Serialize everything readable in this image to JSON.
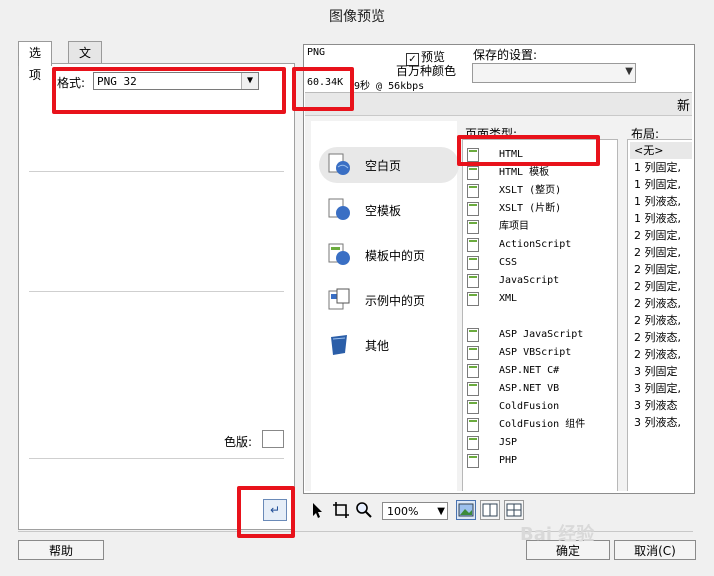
{
  "window": {
    "title": "图像预览"
  },
  "left": {
    "tabs": [
      {
        "label": "选项"
      },
      {
        "label": "文件"
      }
    ],
    "format": {
      "label": "格式:",
      "value": "PNG 32"
    },
    "palette_label": "色版:"
  },
  "preview": {
    "format": "PNG",
    "size": "60.34K",
    "time": "9秒 @ 56kbps",
    "checkbox_label": "预览",
    "color_mode": "百万种颜色",
    "saved_settings_label": "保存的设置:",
    "saved_settings_value": ""
  },
  "inner": {
    "header_new": "新",
    "categories": [
      {
        "label": "空白页"
      },
      {
        "label": "空模板"
      },
      {
        "label": "模板中的页"
      },
      {
        "label": "示例中的页"
      },
      {
        "label": "其他"
      }
    ],
    "page_type_title": "页面类型:",
    "page_types": [
      "HTML",
      "HTML 模板",
      "XSLT (整页)",
      "XSLT (片断)",
      "库项目",
      "ActionScript",
      "CSS",
      "JavaScript",
      "XML",
      "",
      "ASP JavaScript",
      "ASP VBScript",
      "ASP.NET C#",
      "ASP.NET VB",
      "ColdFusion",
      "ColdFusion 组件",
      "JSP",
      "PHP"
    ],
    "layout_title": "布局:",
    "layouts": [
      "<无>",
      "1 列固定,",
      "1 列固定,",
      "1 列液态,",
      "1 列液态,",
      "2 列固定,",
      "2 列固定,",
      "2 列固定,",
      "2 列固定,",
      "2 列液态,",
      "2 列液态,",
      "2 列液态,",
      "2 列液态,",
      "3 列固定",
      "3 列固定,",
      "3 列液态",
      "3 列液态,"
    ]
  },
  "toolbar": {
    "zoom": "100%"
  },
  "buttons": {
    "help": "帮助",
    "ok": "确定",
    "cancel": "取消(C)"
  },
  "colors": {
    "callout": "#e8121b",
    "accent": "#3a6fc4"
  }
}
